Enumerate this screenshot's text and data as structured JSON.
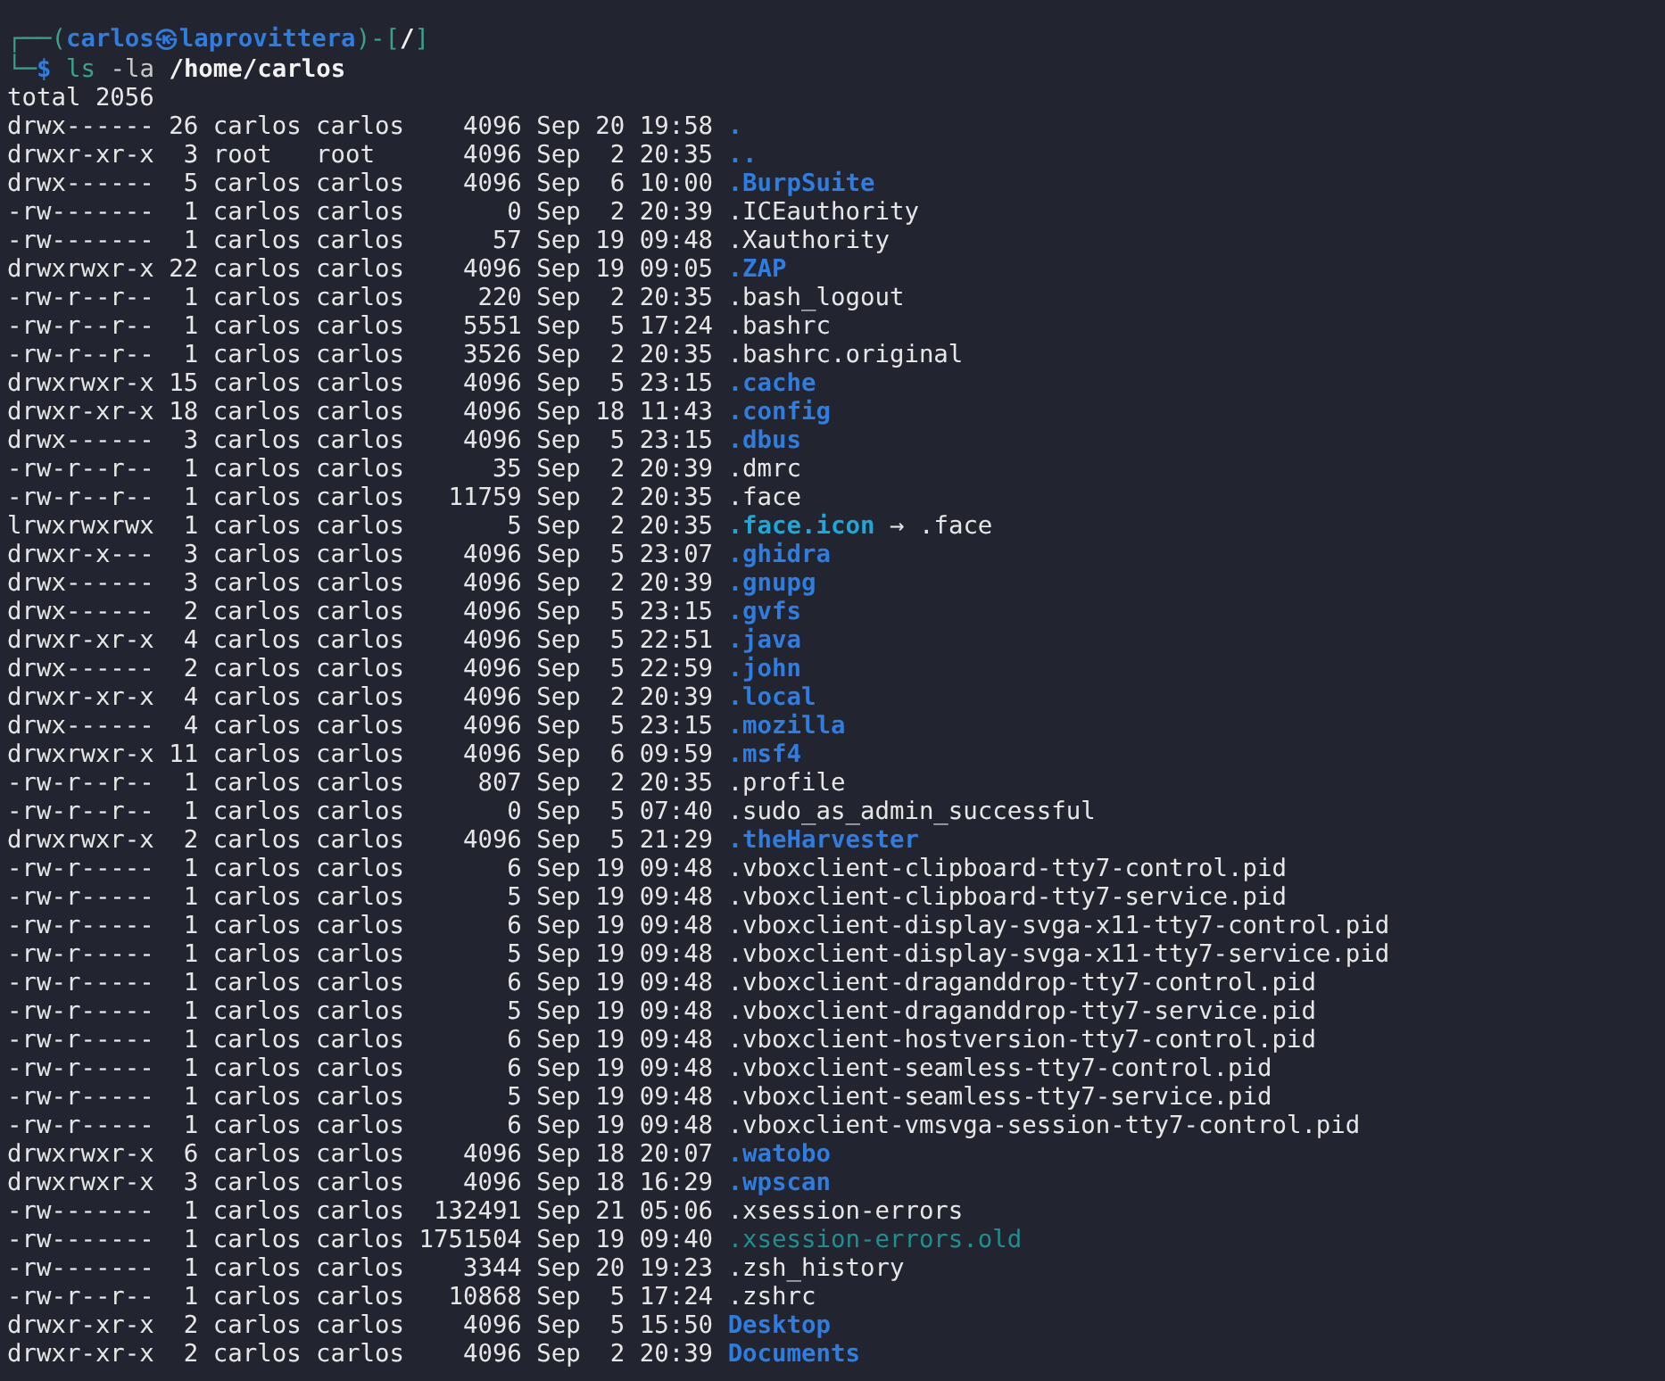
{
  "prompt": {
    "open": "┌──(",
    "user_host": "carlos㉿laprovittera",
    "mid": ")-[",
    "cwd": "/",
    "close": "]",
    "corner": "└─",
    "symbol": "$",
    "command": "ls",
    "options": "-la",
    "path": "/home/carlos"
  },
  "total": "total 2056",
  "rows": [
    {
      "details": "drwx------ 26 carlos carlos    4096 Sep 20 19:58",
      "name": ".",
      "kind": "dir"
    },
    {
      "details": "drwxr-xr-x  3 root   root      4096 Sep  2 20:35",
      "name": "..",
      "kind": "dir"
    },
    {
      "details": "drwx------  5 carlos carlos    4096 Sep  6 10:00",
      "name": ".BurpSuite",
      "kind": "dir"
    },
    {
      "details": "-rw-------  1 carlos carlos       0 Sep  2 20:39",
      "name": ".ICEauthority",
      "kind": "file"
    },
    {
      "details": "-rw-------  1 carlos carlos      57 Sep 19 09:48",
      "name": ".Xauthority",
      "kind": "file"
    },
    {
      "details": "drwxrwxr-x 22 carlos carlos    4096 Sep 19 09:05",
      "name": ".ZAP",
      "kind": "dir"
    },
    {
      "details": "-rw-r--r--  1 carlos carlos     220 Sep  2 20:35",
      "name": ".bash_logout",
      "kind": "file"
    },
    {
      "details": "-rw-r--r--  1 carlos carlos    5551 Sep  5 17:24",
      "name": ".bashrc",
      "kind": "file"
    },
    {
      "details": "-rw-r--r--  1 carlos carlos    3526 Sep  2 20:35",
      "name": ".bashrc.original",
      "kind": "file"
    },
    {
      "details": "drwxrwxr-x 15 carlos carlos    4096 Sep  5 23:15",
      "name": ".cache",
      "kind": "dir"
    },
    {
      "details": "drwxr-xr-x 18 carlos carlos    4096 Sep 18 11:43",
      "name": ".config",
      "kind": "dir"
    },
    {
      "details": "drwx------  3 carlos carlos    4096 Sep  5 23:15",
      "name": ".dbus",
      "kind": "dir"
    },
    {
      "details": "-rw-r--r--  1 carlos carlos      35 Sep  2 20:39",
      "name": ".dmrc",
      "kind": "file"
    },
    {
      "details": "-rw-r--r--  1 carlos carlos   11759 Sep  2 20:35",
      "name": ".face",
      "kind": "file"
    },
    {
      "details": "lrwxrwxrwx  1 carlos carlos       5 Sep  2 20:35",
      "name": ".face.icon",
      "kind": "link",
      "arrow": "→",
      "target": ".face"
    },
    {
      "details": "drwxr-x---  3 carlos carlos    4096 Sep  5 23:07",
      "name": ".ghidra",
      "kind": "dir"
    },
    {
      "details": "drwx------  3 carlos carlos    4096 Sep  2 20:39",
      "name": ".gnupg",
      "kind": "dir"
    },
    {
      "details": "drwx------  2 carlos carlos    4096 Sep  5 23:15",
      "name": ".gvfs",
      "kind": "dir"
    },
    {
      "details": "drwxr-xr-x  4 carlos carlos    4096 Sep  5 22:51",
      "name": ".java",
      "kind": "dir"
    },
    {
      "details": "drwx------  2 carlos carlos    4096 Sep  5 22:59",
      "name": ".john",
      "kind": "dir"
    },
    {
      "details": "drwxr-xr-x  4 carlos carlos    4096 Sep  2 20:39",
      "name": ".local",
      "kind": "dir"
    },
    {
      "details": "drwx------  4 carlos carlos    4096 Sep  5 23:15",
      "name": ".mozilla",
      "kind": "dir"
    },
    {
      "details": "drwxrwxr-x 11 carlos carlos    4096 Sep  6 09:59",
      "name": ".msf4",
      "kind": "dir"
    },
    {
      "details": "-rw-r--r--  1 carlos carlos     807 Sep  2 20:35",
      "name": ".profile",
      "kind": "file"
    },
    {
      "details": "-rw-r--r--  1 carlos carlos       0 Sep  5 07:40",
      "name": ".sudo_as_admin_successful",
      "kind": "file"
    },
    {
      "details": "drwxrwxr-x  2 carlos carlos    4096 Sep  5 21:29",
      "name": ".theHarvester",
      "kind": "dir"
    },
    {
      "details": "-rw-r-----  1 carlos carlos       6 Sep 19 09:48",
      "name": ".vboxclient-clipboard-tty7-control.pid",
      "kind": "file"
    },
    {
      "details": "-rw-r-----  1 carlos carlos       5 Sep 19 09:48",
      "name": ".vboxclient-clipboard-tty7-service.pid",
      "kind": "file"
    },
    {
      "details": "-rw-r-----  1 carlos carlos       6 Sep 19 09:48",
      "name": ".vboxclient-display-svga-x11-tty7-control.pid",
      "kind": "file"
    },
    {
      "details": "-rw-r-----  1 carlos carlos       5 Sep 19 09:48",
      "name": ".vboxclient-display-svga-x11-tty7-service.pid",
      "kind": "file"
    },
    {
      "details": "-rw-r-----  1 carlos carlos       6 Sep 19 09:48",
      "name": ".vboxclient-draganddrop-tty7-control.pid",
      "kind": "file"
    },
    {
      "details": "-rw-r-----  1 carlos carlos       5 Sep 19 09:48",
      "name": ".vboxclient-draganddrop-tty7-service.pid",
      "kind": "file"
    },
    {
      "details": "-rw-r-----  1 carlos carlos       6 Sep 19 09:48",
      "name": ".vboxclient-hostversion-tty7-control.pid",
      "kind": "file"
    },
    {
      "details": "-rw-r-----  1 carlos carlos       6 Sep 19 09:48",
      "name": ".vboxclient-seamless-tty7-control.pid",
      "kind": "file"
    },
    {
      "details": "-rw-r-----  1 carlos carlos       5 Sep 19 09:48",
      "name": ".vboxclient-seamless-tty7-service.pid",
      "kind": "file"
    },
    {
      "details": "-rw-r-----  1 carlos carlos       6 Sep 19 09:48",
      "name": ".vboxclient-vmsvga-session-tty7-control.pid",
      "kind": "file"
    },
    {
      "details": "drwxrwxr-x  6 carlos carlos    4096 Sep 18 20:07",
      "name": ".watobo",
      "kind": "dir"
    },
    {
      "details": "drwxrwxr-x  3 carlos carlos    4096 Sep 18 16:29",
      "name": ".wpscan",
      "kind": "dir"
    },
    {
      "details": "-rw-------  1 carlos carlos  132491 Sep 21 05:06",
      "name": ".xsession-errors",
      "kind": "file"
    },
    {
      "details": "-rw-------  1 carlos carlos 1751504 Sep 19 09:40",
      "name": ".xsession-errors.old",
      "kind": "archive"
    },
    {
      "details": "-rw-------  1 carlos carlos    3344 Sep 20 19:23",
      "name": ".zsh_history",
      "kind": "file"
    },
    {
      "details": "-rw-r--r--  1 carlos carlos   10868 Sep  5 17:24",
      "name": ".zshrc",
      "kind": "file"
    },
    {
      "details": "drwxr-xr-x  2 carlos carlos    4096 Sep  5 15:50",
      "name": "Desktop",
      "kind": "dir"
    },
    {
      "details": "drwxr-xr-x  2 carlos carlos    4096 Sep  2 20:39",
      "name": "Documents",
      "kind": "dir"
    }
  ]
}
